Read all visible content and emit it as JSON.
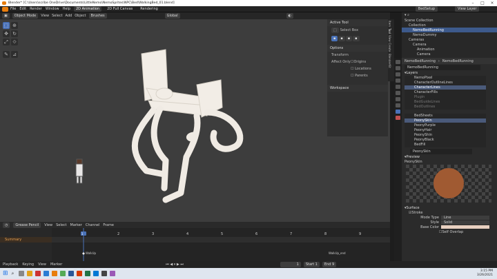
{
  "window": {
    "title": "Blender* [C:\\Users\\scribe OneDrive\\Documents\\LittleNemo\\NemoSprites\\NPC\\Bed\\WalkingBed_01.blend]"
  },
  "menu": {
    "items": [
      "File",
      "Edit",
      "Render",
      "Window",
      "Help"
    ],
    "tabs": [
      "2D Animation",
      "2D Full Canvas",
      "Rendering"
    ],
    "scene": "BedSetup",
    "view_layer": "View Layer"
  },
  "viewport_header": {
    "mode": "Object Mode",
    "items": [
      "View",
      "Select",
      "Add",
      "Object"
    ],
    "brush": "Brushes",
    "orientation": "Global"
  },
  "npanel": {
    "active_tool": "Active Tool",
    "select_box": "Select Box",
    "options": "Options",
    "transform": "Transform",
    "affect_only": "Affect Only",
    "opt1": "Origins",
    "opt2": "Locations",
    "opt3": "Parents",
    "workspace": "Workspace",
    "tabs": [
      "Item",
      "Tool",
      "View",
      "Create",
      "BlenderKit"
    ]
  },
  "outliner": {
    "items": [
      "Scene Collection",
      "Collection",
      "NemoBedRunning",
      "NemoDummy",
      "Cameras",
      "Camera",
      "Animation",
      "Camera"
    ]
  },
  "properties": {
    "object_name": "NemoBedRunning",
    "object_name2": "NemoBedRunning",
    "layers_label": "Layers",
    "layers": [
      "NemoPixel",
      "CharacterOutlineLines",
      "CharacterLines",
      "CharacterFills",
      "Plugin",
      "BedGuideLines",
      "BedOutlines"
    ],
    "selected_layer": "CharacterLines",
    "materials": [
      "BedSheets",
      "PeonySkin",
      "PeonyPurple",
      "PeonyHair",
      "PeonyShin",
      "PeonyBlack",
      "BedFill"
    ],
    "selected_material": "PeonySkin",
    "material_field": "PeonySkin",
    "preview_label": "Preview",
    "preview_name": "PeonySkin",
    "surface_label": "Surface",
    "stroke_label": "Stroke",
    "mode_type_label": "Mode Type",
    "mode_type_value": "Line",
    "style_label": "Style",
    "style_value": "Solid",
    "base_color_label": "Base Color",
    "self_overlap": "Self Overlap"
  },
  "timeline": {
    "mode": "Grease Pencil",
    "items": [
      "View",
      "Select",
      "Marker",
      "Channel",
      "Frame"
    ],
    "track": "Summary",
    "frames": [
      "1",
      "2",
      "3",
      "4",
      "5",
      "6",
      "7",
      "8",
      "9"
    ],
    "current_frame": "1",
    "marker1": "WalkUp",
    "marker2": "WalkUp_end"
  },
  "playback": {
    "items": [
      "Playback",
      "Keying",
      "View",
      "Marker"
    ],
    "frame": "1",
    "start_label": "Start",
    "start": "1",
    "end_label": "End",
    "end": "9"
  },
  "taskbar": {
    "time": "3:15 PM",
    "date": "3/26/2021"
  },
  "colors": {
    "accent": "#4a72b8",
    "selection": "#3d5a8c",
    "orange": "#e87d0d",
    "material_preview": "#a05a32"
  }
}
